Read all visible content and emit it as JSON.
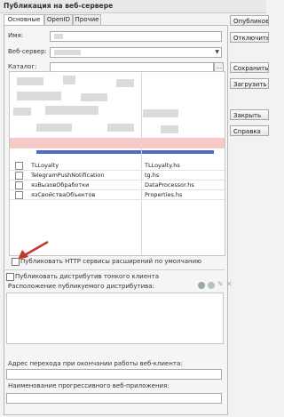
{
  "window": {
    "title": "Публикация на веб-сервере"
  },
  "tabs": [
    {
      "label": "Основные",
      "active": true
    },
    {
      "label": "OpenID",
      "active": false
    },
    {
      "label": "Прочие",
      "active": false
    }
  ],
  "fields": {
    "name_label": "Имя:",
    "webserver_label": "Веб-сервер:",
    "catalog_label": "Каталог:"
  },
  "buttons": [
    "Опубликовать",
    "Отключить",
    "Сохранить",
    "Загрузить",
    "Закрыть",
    "Справка"
  ],
  "services_table": {
    "rows": [
      {
        "name": "TLLoyalty",
        "file": "TLLoyalty.hs"
      },
      {
        "name": "TelegramPushNotification",
        "file": "tg.hs"
      },
      {
        "name": "язВызовОбработки",
        "file": "DataProcessor.hs"
      },
      {
        "name": "язСвойстваОбъектов",
        "file": "Properties.hs"
      }
    ]
  },
  "checkboxes": {
    "publish_http_ext": "Публиковать HTTP сервисы расширений по умолчанию",
    "publish_thin_client": "Публиковать дистрибутив тонкого клиента"
  },
  "thin_client": {
    "location_label": "Расположение публикуемого дистрибутива:"
  },
  "bottom_fields": {
    "exit_url_label": "Адрес перехода при окончании работы веб-клиента:",
    "pwa_name_label": "Наименование прогрессивного веб-приложения:"
  },
  "colors": {
    "arrow": "#c0392b",
    "accent_blue": "#4a6cc7",
    "pink_band": "#f6c8c6"
  }
}
